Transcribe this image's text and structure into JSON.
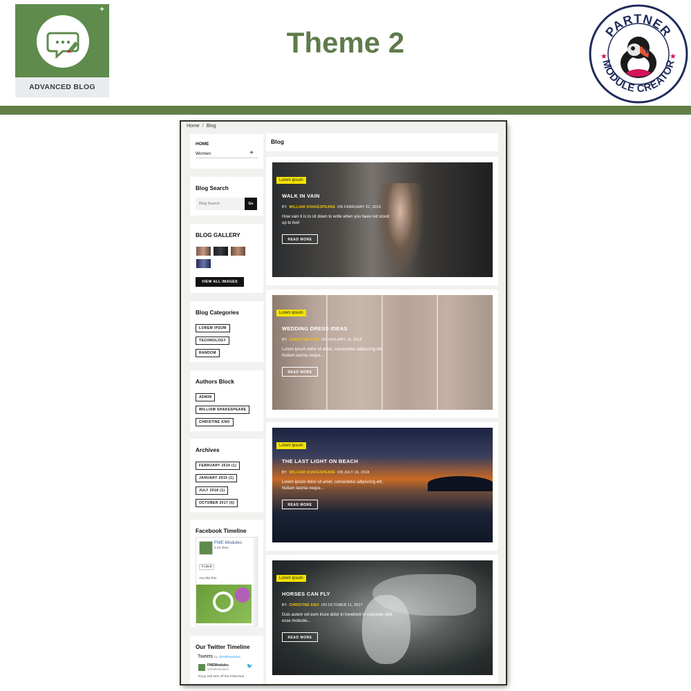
{
  "header": {
    "logo_label": "ADVANCED BLOG",
    "title": "Theme 2",
    "badge_top": "PARTNER",
    "badge_bottom": "MODULE CREATOR"
  },
  "colors": {
    "brand_green": "#5f8b4c",
    "title_green": "#5f7b4a",
    "bar_green": "#627f48",
    "tag_yellow": "#f4e300",
    "badge_navy": "#1e2a5a",
    "badge_pink": "#d4145a"
  },
  "breadcrumb": {
    "home": "Home",
    "sep": "/",
    "current": "Blog"
  },
  "sidebar": {
    "nav": {
      "home": "HOME",
      "women": "Women",
      "expand": "+"
    },
    "search": {
      "title": "Blog Search",
      "placeholder": "Blog Search",
      "button": "Go"
    },
    "gallery": {
      "title": "BLOG GALLERY",
      "button": "VIEW ALL IMAGES"
    },
    "categories": {
      "title": "Blog Categories",
      "items": [
        "LOREM IPSUM",
        "TECHNOLOGY",
        "RANDOM"
      ]
    },
    "authors": {
      "title": "Authors Block",
      "items": [
        "ADMIN",
        "WILLIAM SHAKESPEARE",
        "CHRISTINE KNO"
      ]
    },
    "archives": {
      "title": "Archives",
      "items": [
        "FEBRUARY 2019 (1)",
        "JANUARY 2019 (1)",
        "JULY 2018 (1)",
        "OCTOBER 2017 (6)"
      ]
    },
    "facebook": {
      "title": "Facebook Timeline",
      "page_name": "FME Modules",
      "likes": "4.2K likes",
      "liked": "Liked",
      "you_like": "You like this"
    },
    "twitter": {
      "title": "Our Twitter Timeline",
      "tweets": "Tweets",
      "by": "by",
      "handle": "@FMEModules",
      "account_name": "FMEModules",
      "account_handle": "@FMEModules",
      "snippet": "Enjoy Sell 20% off this #NewYear"
    }
  },
  "main": {
    "heading": "Blog",
    "posts": [
      {
        "tag": "Lorem ipsum",
        "title": "WALK IN VAIN",
        "by": "BY",
        "author": "WILLIAM SHAKESPEARE",
        "date": "ON FEBRUARY 22, 2019",
        "excerpt": "How vain it is to sit down to write when you have not stood up to live!",
        "read_more": "READ MORE"
      },
      {
        "tag": "Lorem ipsum",
        "title": "WEDDING DRESS IDEAS",
        "by": "BY",
        "author": "CHRISTINE KNO",
        "date": "ON JANUARY 16, 2019",
        "excerpt": "Lorem ipsum dolor sit amet, consectetur adipiscing elit. Nullam lacinia neque...",
        "read_more": "READ MORE"
      },
      {
        "tag": "Lorem ipsum",
        "title": "THE LAST LIGHT ON BEACH",
        "by": "BY",
        "author": "WILLIAM SHAKESPEARE",
        "date": "ON JULY 16, 2018",
        "excerpt": "Lorem ipsum dolor sit amet, consectetur adipiscing elit. Nullam lacinia neque...",
        "read_more": "READ MORE"
      },
      {
        "tag": "Lorem ipsum",
        "title": "HORSES CAN FLY",
        "by": "BY",
        "author": "CHRISTINE KNO",
        "date": "ON OCTOBER 11, 2017",
        "excerpt": "Duis autem vel eum iriure dolor in hendrerit in vulputate velit esse molestie...",
        "read_more": "READ MORE"
      }
    ]
  }
}
